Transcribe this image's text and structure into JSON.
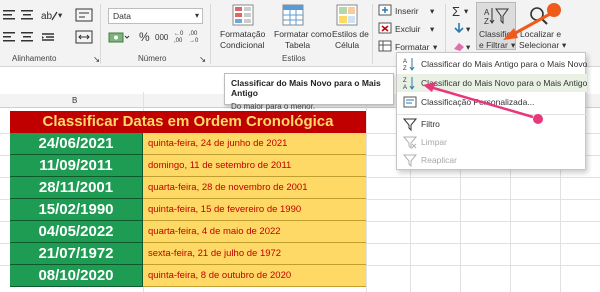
{
  "ribbon": {
    "groups": {
      "alignment": "Alinhamento",
      "number": "Número",
      "styles": "Estilos"
    },
    "number_format": "Data",
    "percent_symbol": "%",
    "thousands_symbol": "000",
    "cells_buttons": {
      "insert": "Inserir",
      "delete": "Excluir",
      "format": "Formatar"
    },
    "big_buttons": {
      "conditional_format": [
        "Formatação",
        "Condicional"
      ],
      "format_table": [
        "Formatar como",
        "Tabela"
      ],
      "cell_styles": [
        "Estilos de",
        "Célula"
      ],
      "sort_filter": [
        "Classificar",
        "e Filtrar"
      ],
      "find_select": [
        "Localizar e",
        "Selecionar"
      ]
    }
  },
  "sheet": {
    "column_letter": "B",
    "title": "Classificar Datas em Ordem Cronológica",
    "rows": [
      {
        "date": "24/06/2021",
        "desc": "quinta-feira, 24 de junho de 2021"
      },
      {
        "date": "11/09/2011",
        "desc": "domingo, 11 de setembro de 2011"
      },
      {
        "date": "28/11/2001",
        "desc": "quarta-feira, 28 de novembro de 2001"
      },
      {
        "date": "15/02/1990",
        "desc": "quinta-feira, 15 de fevereiro de 1990"
      },
      {
        "date": "04/05/2022",
        "desc": "quarta-feira, 4 de maio de 2022"
      },
      {
        "date": "21/07/1972",
        "desc": "sexta-feira, 21 de julho de 1972"
      },
      {
        "date": "08/10/2020",
        "desc": "quinta-feira, 8 de outubro de 2020"
      }
    ]
  },
  "tooltip": {
    "title": "Classificar do Mais Novo para o Mais Antigo",
    "body": "Do maior para o menor."
  },
  "menu": {
    "items": [
      {
        "label": "Classificar do Mais Antigo para o Mais Novo",
        "icon": "sort-ascending-icon"
      },
      {
        "label": "Classificar do Mais Novo para o Mais Antigo",
        "icon": "sort-descending-icon"
      },
      {
        "label": "Classificação Personalizada...",
        "icon": "custom-sort-icon"
      },
      {
        "label": "Filtro",
        "icon": "filter-icon"
      },
      {
        "label": "Limpar",
        "icon": "clear-filter-icon"
      },
      {
        "label": "Reaplicar",
        "icon": "reapply-icon"
      }
    ]
  },
  "colors": {
    "title_bg": "#c00000",
    "title_text": "#ffd966",
    "date_bg": "#1e9c53",
    "desc_bg": "#ffd966",
    "annotation_pink": "#e8377b",
    "annotation_orange": "#f05a1a"
  }
}
